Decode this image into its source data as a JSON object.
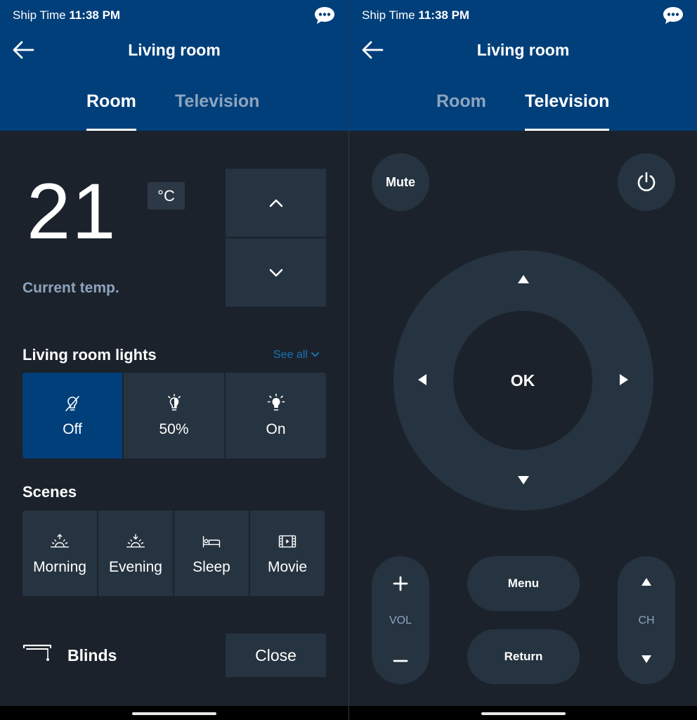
{
  "status": {
    "label": "Ship Time",
    "time": "11:38 PM"
  },
  "header": {
    "title": "Living room"
  },
  "tabs": [
    {
      "label": "Room"
    },
    {
      "label": "Television"
    }
  ],
  "room": {
    "temperature": "21",
    "unit": "°C",
    "current_temp_label": "Current temp.",
    "lights": {
      "title": "Living room lights",
      "see_all": "See all",
      "options": [
        {
          "label": "Off",
          "icon": "light-off-icon",
          "selected": true
        },
        {
          "label": "50%",
          "icon": "light-dim-icon",
          "selected": false
        },
        {
          "label": "On",
          "icon": "light-on-icon",
          "selected": false
        }
      ]
    },
    "scenes": {
      "title": "Scenes",
      "options": [
        {
          "label": "Morning",
          "icon": "sunrise-icon"
        },
        {
          "label": "Evening",
          "icon": "sunset-icon"
        },
        {
          "label": "Sleep",
          "icon": "bed-icon"
        },
        {
          "label": "Movie",
          "icon": "film-icon"
        }
      ]
    },
    "blinds": {
      "label": "Blinds",
      "action": "Close"
    }
  },
  "tv": {
    "mute": "Mute",
    "ok": "OK",
    "menu": "Menu",
    "return": "Return",
    "vol": "VOL",
    "ch": "CH"
  },
  "colors": {
    "header_bg": "#013f7a",
    "screen_bg": "#1b222b",
    "tile_bg": "#263340",
    "muted_text": "#8ea4bd",
    "link": "#1a73b5"
  }
}
